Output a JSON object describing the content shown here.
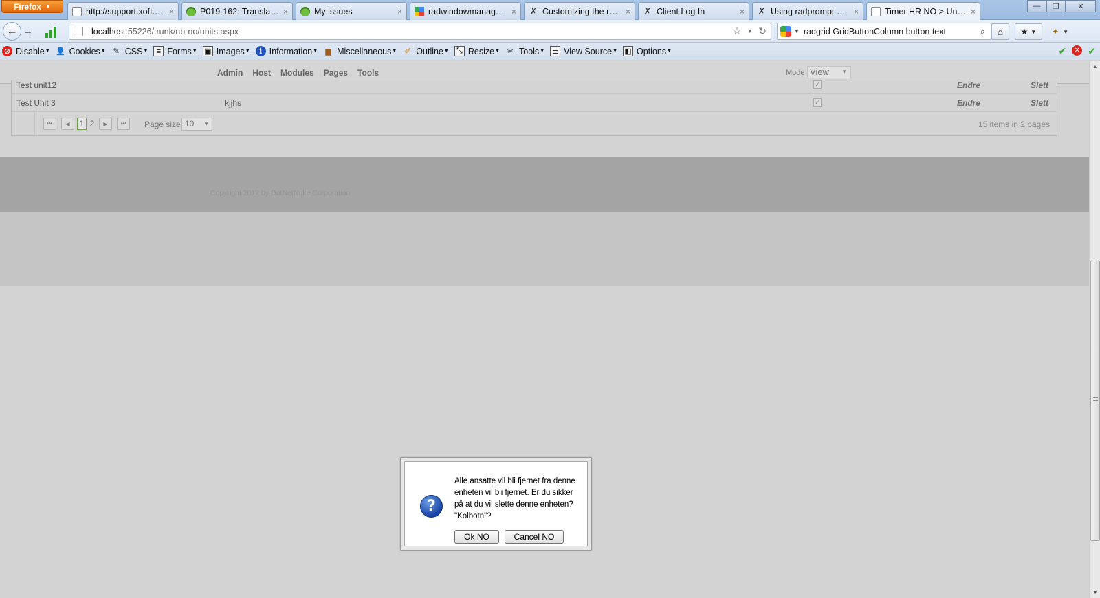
{
  "browser": {
    "menu_button": "Firefox",
    "tabs": [
      {
        "label": "http://support.xoft.no/",
        "icon": "page-icon",
        "close": "×"
      },
      {
        "label": "P019-162: Translation...",
        "icon": "frog-icon",
        "close": "×"
      },
      {
        "label": "My issues",
        "icon": "frog-icon",
        "close": "×"
      },
      {
        "label": "radwindowmanager c...",
        "icon": "google-icon",
        "close": "×"
      },
      {
        "label": "Customizing the radc...",
        "icon": "telerik-icon",
        "close": "×"
      },
      {
        "label": "Client Log In",
        "icon": "telerik-icon",
        "close": "×"
      },
      {
        "label": "Using radprompt and ...",
        "icon": "telerik-icon",
        "close": "×"
      },
      {
        "label": "Timer HR NO > Units ...",
        "icon": "page-icon",
        "close": "×",
        "active": true
      }
    ],
    "url": {
      "host": "localhost",
      "rest": ":55226/trunk/nb-no/units.aspx"
    },
    "search": {
      "value": "radgrid GridButtonColumn button text"
    }
  },
  "devtoolbar": {
    "items": [
      {
        "label": "Disable",
        "icon": "disable-icon"
      },
      {
        "label": "Cookies",
        "icon": "cookie-icon"
      },
      {
        "label": "CSS",
        "icon": "css-icon"
      },
      {
        "label": "Forms",
        "icon": "forms-icon"
      },
      {
        "label": "Images",
        "icon": "images-icon"
      },
      {
        "label": "Information",
        "icon": "information-icon"
      },
      {
        "label": "Miscellaneous",
        "icon": "miscellaneous-icon"
      },
      {
        "label": "Outline",
        "icon": "outline-icon"
      },
      {
        "label": "Resize",
        "icon": "resize-icon"
      },
      {
        "label": "Tools",
        "icon": "tools-icon"
      },
      {
        "label": "View Source",
        "icon": "view-source-icon"
      },
      {
        "label": "Options",
        "icon": "options-icon"
      }
    ]
  },
  "controlpanel": {
    "menu": [
      "Admin",
      "Host",
      "Modules",
      "Pages",
      "Tools"
    ],
    "mode_label": "Mode",
    "mode_value": "View"
  },
  "grid": {
    "rows": [
      {
        "name": "Test unit12",
        "description": "",
        "checked": true,
        "edit": "Endre",
        "delete": "Slett"
      },
      {
        "name": "Test Unit 3",
        "description": "kjjhs",
        "checked": true,
        "edit": "Endre",
        "delete": "Slett"
      }
    ],
    "pager": {
      "pages": [
        "1",
        "2"
      ],
      "current_page": "1",
      "page_size_label": "Page size:",
      "page_size_value": "10",
      "info": "15 items in 2 pages"
    }
  },
  "footer": {
    "copyright": "Copyright 2012 by DotNetNuke Corporation"
  },
  "dialog": {
    "message": "Alle ansatte vil bli fjernet fra denne enheten vil bli fjernet. Er du sikker på at du vil slette denne enheten? \"Kolbotn\"?",
    "ok_label": "Ok NO",
    "cancel_label": "Cancel NO"
  }
}
